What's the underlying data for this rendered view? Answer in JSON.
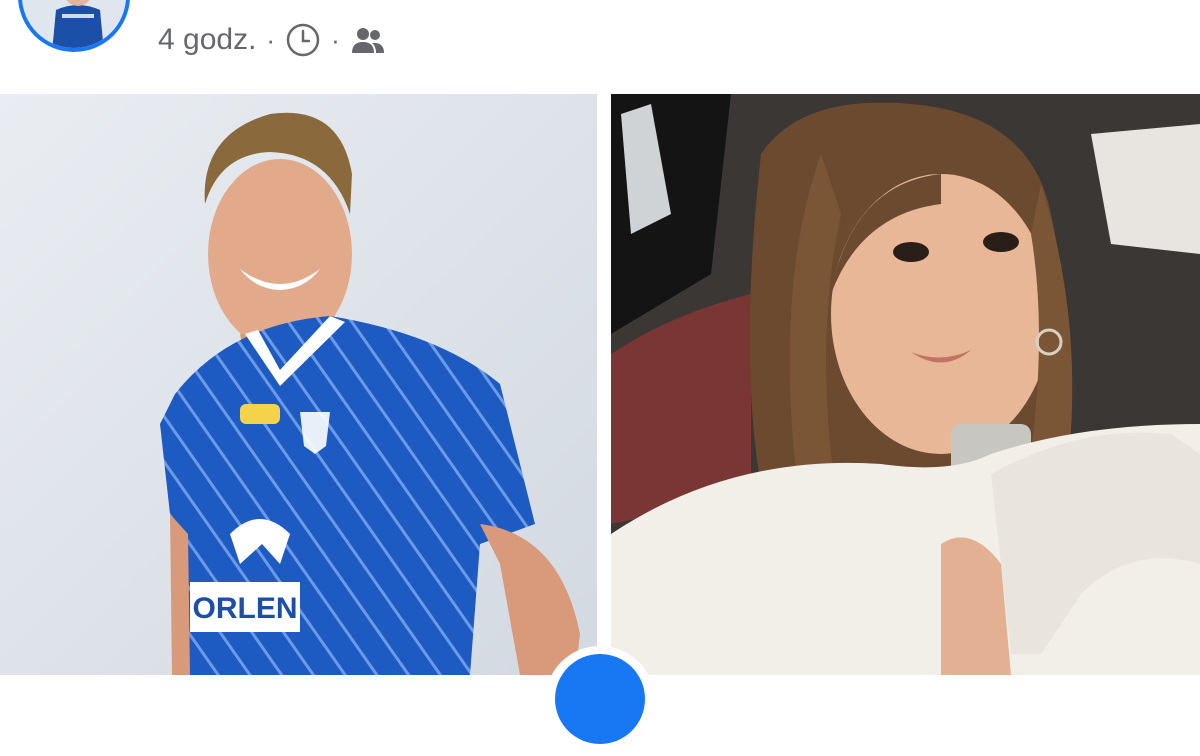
{
  "post": {
    "time": "4 godz.",
    "separator": "·",
    "icons": {
      "clock": "clock-icon",
      "audience": "friends-icon"
    }
  },
  "photos": {
    "left": {
      "sponsor_text": "ORLEN"
    }
  },
  "colors": {
    "facebook_blue": "#1877f2",
    "meta_gray": "#65676b",
    "jersey_blue": "#1c4fa8"
  }
}
